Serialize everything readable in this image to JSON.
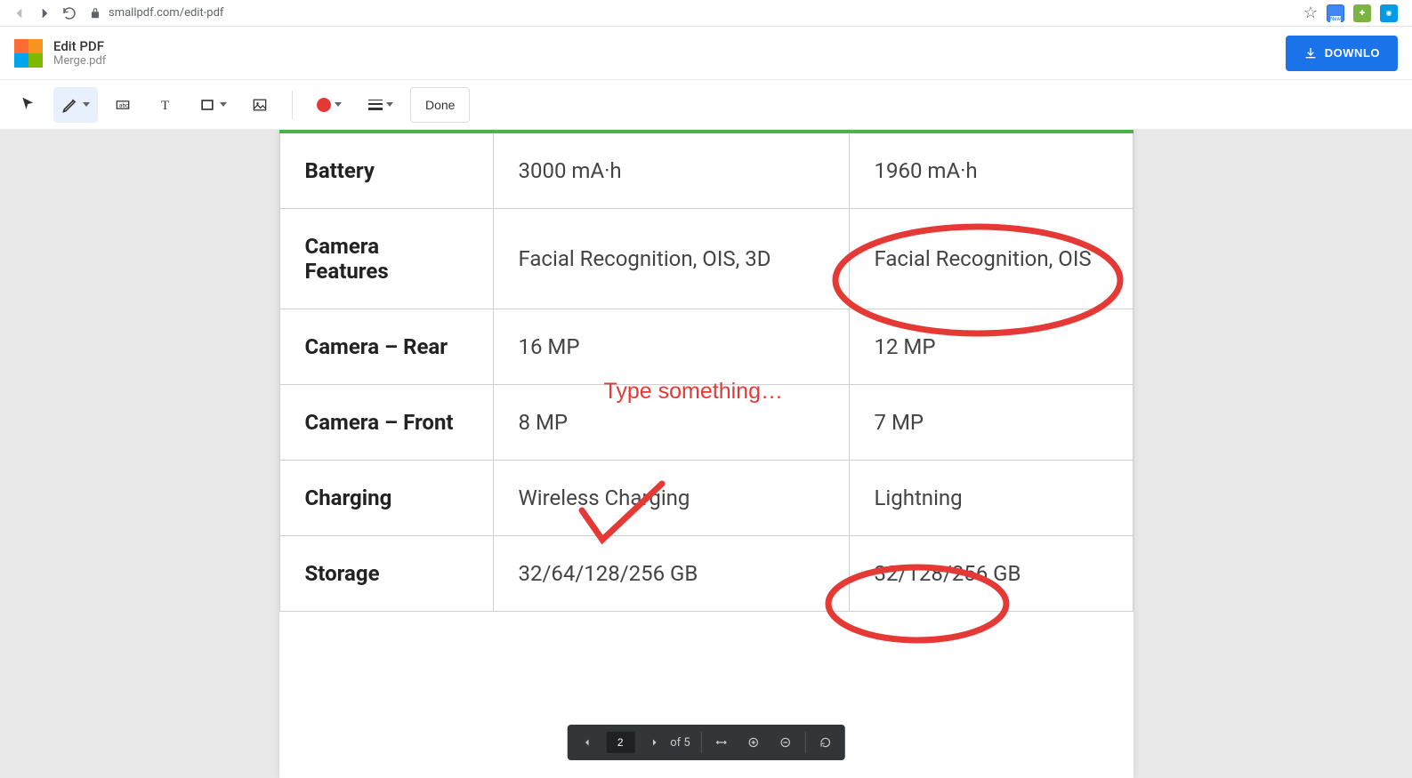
{
  "browser": {
    "url": "smallpdf.com/edit-pdf"
  },
  "header": {
    "app_title": "Edit PDF",
    "file_name": "Merge.pdf",
    "download_label": "DOWNLO"
  },
  "toolbar": {
    "done_label": "Done"
  },
  "table": {
    "rows": [
      {
        "label": "Battery",
        "col1": "3000 mA·h",
        "col2": "1960 mA·h"
      },
      {
        "label": "Camera Features",
        "col1": "Facial Recognition, OIS, 3D",
        "col2": "Facial Recognition, OIS"
      },
      {
        "label": "Camera – Rear",
        "col1": "16 MP",
        "col2": "12 MP"
      },
      {
        "label": "Camera – Front",
        "col1": "8 MP",
        "col2": "7 MP"
      },
      {
        "label": "Charging",
        "col1": "Wireless Charging",
        "col2": "Lightning"
      },
      {
        "label": "Storage",
        "col1": "32/64/128/256 GB",
        "col2": "32/128/256 GB"
      }
    ]
  },
  "annotations": {
    "text_placeholder": "Type something…"
  },
  "page_control": {
    "current_page": "2",
    "page_total_label": "of 5"
  }
}
